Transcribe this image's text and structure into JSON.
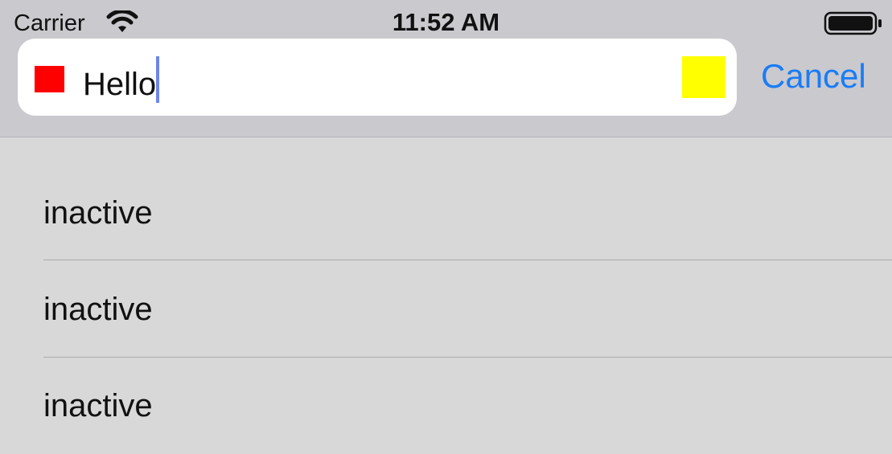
{
  "status_bar": {
    "carrier": "Carrier",
    "time": "11:52 AM",
    "wifi_icon": "wifi-icon",
    "battery_icon": "battery-icon"
  },
  "search": {
    "value": "Hello",
    "left_view_color": "#ff0000",
    "right_view_color": "#ffff00",
    "cursor_color": "#6e86e8",
    "background": "#ffffff"
  },
  "cancel_label": "Cancel",
  "accent_color": "#1a7cf5",
  "list": {
    "items": [
      {
        "label": "inactive"
      },
      {
        "label": "inactive"
      },
      {
        "label": "inactive"
      }
    ]
  }
}
